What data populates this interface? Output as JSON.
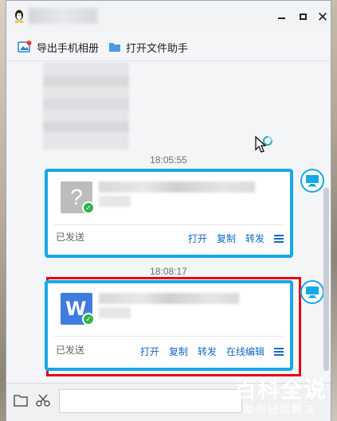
{
  "toolbar": {
    "export_label": "导出手机相册",
    "helper_label": "打开文件助手"
  },
  "messages": [
    {
      "time": "18:05:55",
      "file_icon": "unknown-file-icon",
      "file_icon_glyph": "?",
      "status": "已发送",
      "actions": [
        "打开",
        "复制",
        "转发"
      ]
    },
    {
      "time": "18:08:17",
      "file_icon": "word-file-icon",
      "file_icon_glyph": "W",
      "status": "已发送",
      "actions": [
        "打开",
        "复制",
        "转发",
        "在线编辑"
      ]
    }
  ],
  "input": {
    "value": ""
  },
  "watermark": {
    "title": "百科全说",
    "subtitle": "助你轻松解决"
  },
  "colors": {
    "accent": "#17a8e6",
    "highlight": "#e60012",
    "link": "#1267c4",
    "word": "#3f7ce0",
    "success": "#2fb34a"
  }
}
